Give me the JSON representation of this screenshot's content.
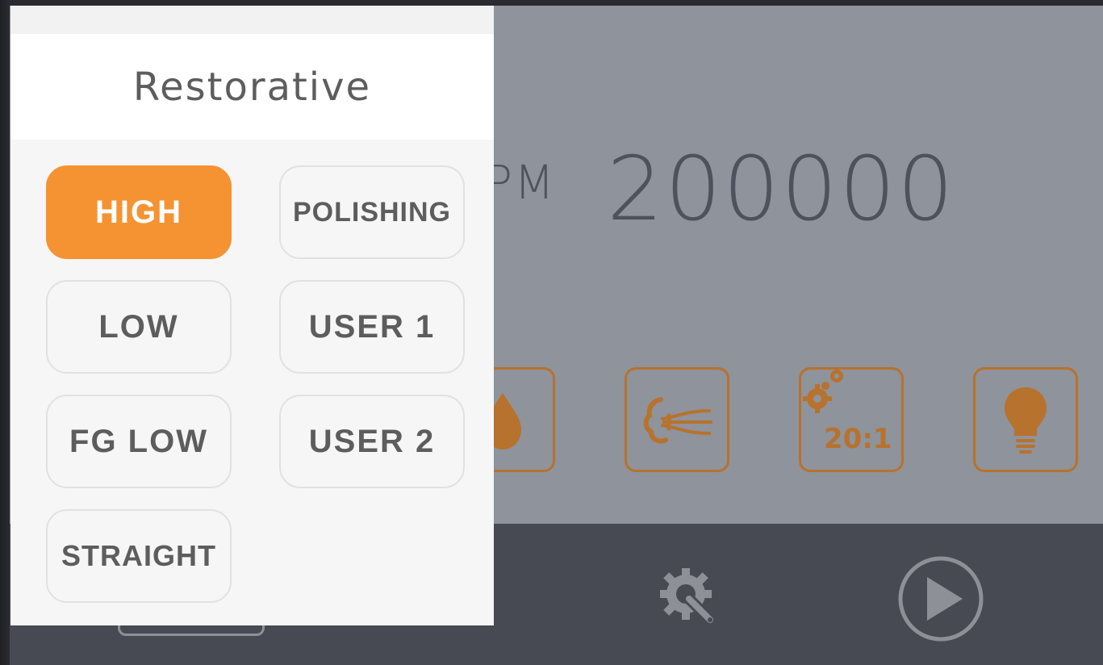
{
  "main": {
    "rpm_label": "PM",
    "rpm_value": "200000",
    "ratio_label": "20:1"
  },
  "popup": {
    "title": "Restorative",
    "modes": [
      {
        "label": "HIGH",
        "active": true
      },
      {
        "label": "POLISHING",
        "active": false
      },
      {
        "label": "LOW",
        "active": false
      },
      {
        "label": "USER 1",
        "active": false
      },
      {
        "label": "FG LOW",
        "active": false
      },
      {
        "label": "USER 2",
        "active": false
      },
      {
        "label": "STRAIGHT",
        "active": false
      }
    ]
  },
  "icons": {
    "water": "water-drop-icon",
    "air": "air-spray-icon",
    "gear_ratio": "gear-ratio-icon",
    "light": "light-bulb-icon",
    "settings": "settings-wrench-icon",
    "play": "play-icon"
  },
  "colors": {
    "accent": "#f59332",
    "icon_brown": "#b7722d",
    "main_bg": "#8f939b",
    "bottom_bg": "#474a52"
  }
}
